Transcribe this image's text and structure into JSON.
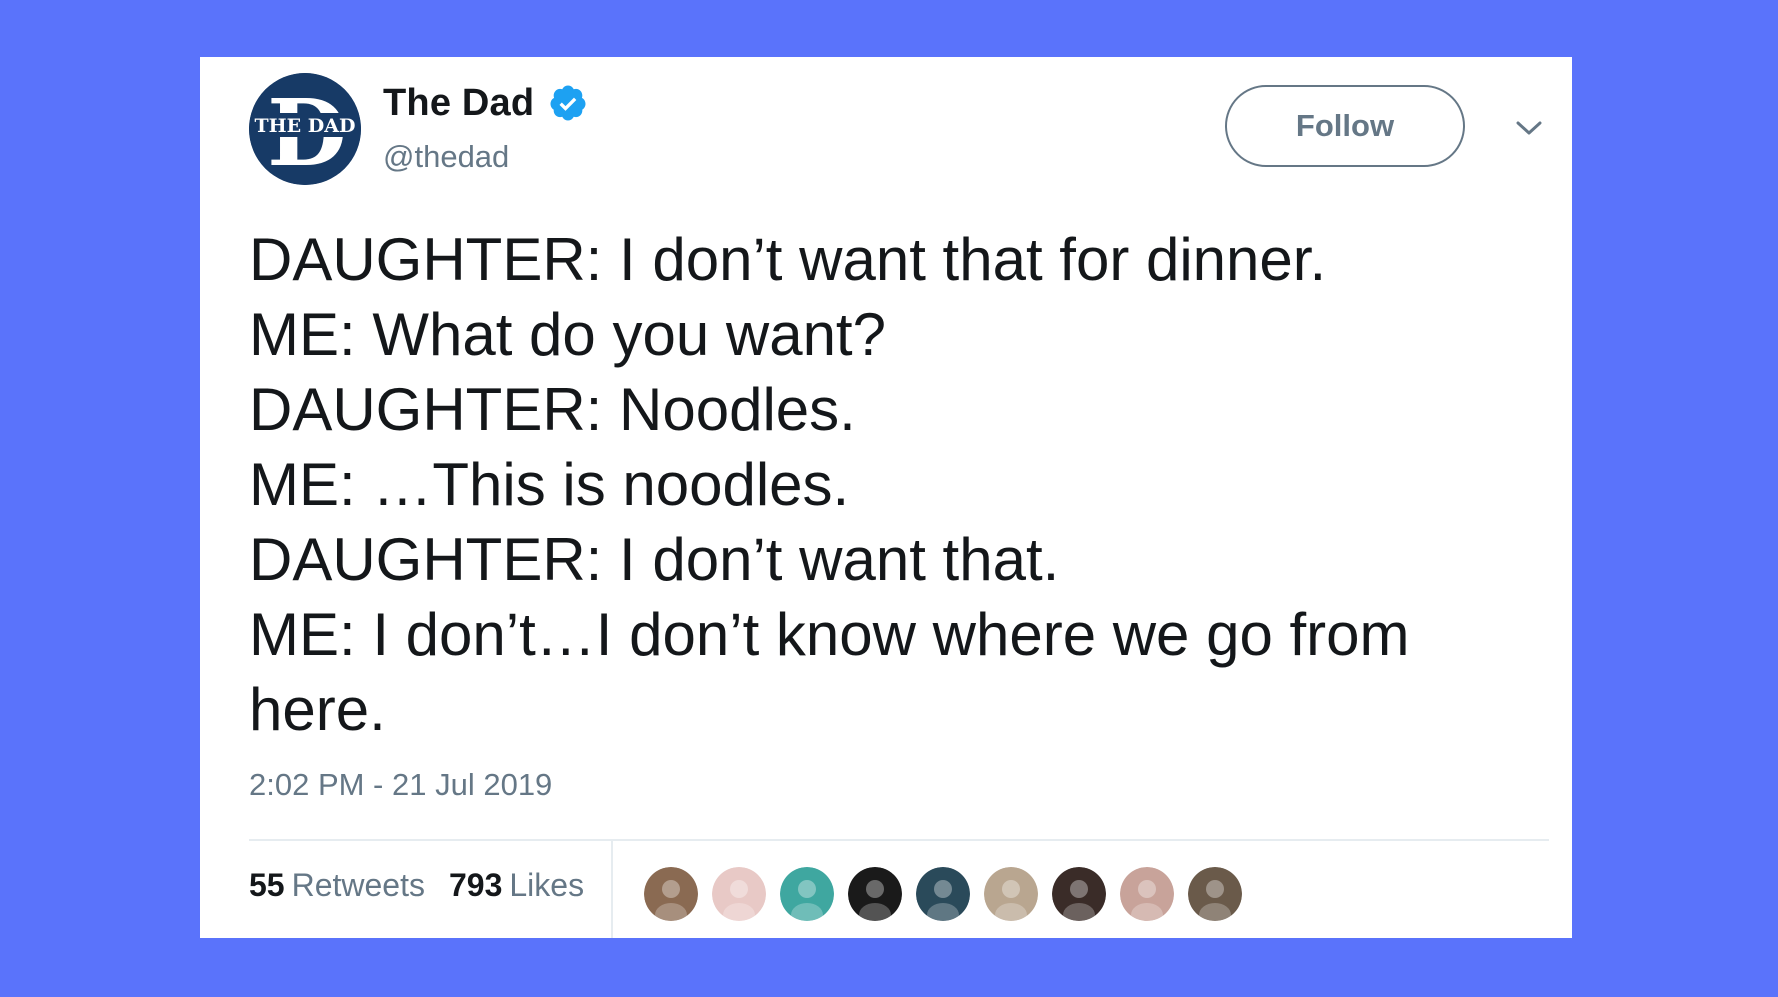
{
  "tweet": {
    "author": {
      "display_name": "The Dad",
      "handle": "@thedad",
      "avatar_text": "THE DAD",
      "avatar_letter": "D",
      "verified": true
    },
    "follow_label": "Follow",
    "text_lines": [
      "DAUGHTER: I don’t want that for dinner.",
      "ME: What do you want?",
      "DAUGHTER: Noodles.",
      "ME: …This is noodles.",
      "DAUGHTER: I don’t want that.",
      "ME: I don’t…I don’t know where we go from",
      "here."
    ],
    "timestamp": "2:02 PM - 21 Jul 2019",
    "stats": {
      "retweets_count": "55",
      "retweets_label": "Retweets",
      "likes_count": "793",
      "likes_label": "Likes"
    },
    "liker_avatars": [
      {
        "icon": "user-avatar",
        "color": "#8a6a52"
      },
      {
        "icon": "user-avatar",
        "color": "#e8c9c6"
      },
      {
        "icon": "user-avatar",
        "color": "#3fa7a0"
      },
      {
        "icon": "user-avatar",
        "color": "#1a1a1a"
      },
      {
        "icon": "user-avatar",
        "color": "#2a4a5a"
      },
      {
        "icon": "user-avatar",
        "color": "#b9a690"
      },
      {
        "icon": "user-avatar",
        "color": "#3a2c28"
      },
      {
        "icon": "user-avatar",
        "color": "#c8a39a"
      },
      {
        "icon": "user-avatar",
        "color": "#6a5a4a"
      }
    ]
  },
  "colors": {
    "background": "#5a73fb",
    "card": "#ffffff",
    "verified_blue": "#1da1f2",
    "secondary_text": "#657786"
  }
}
